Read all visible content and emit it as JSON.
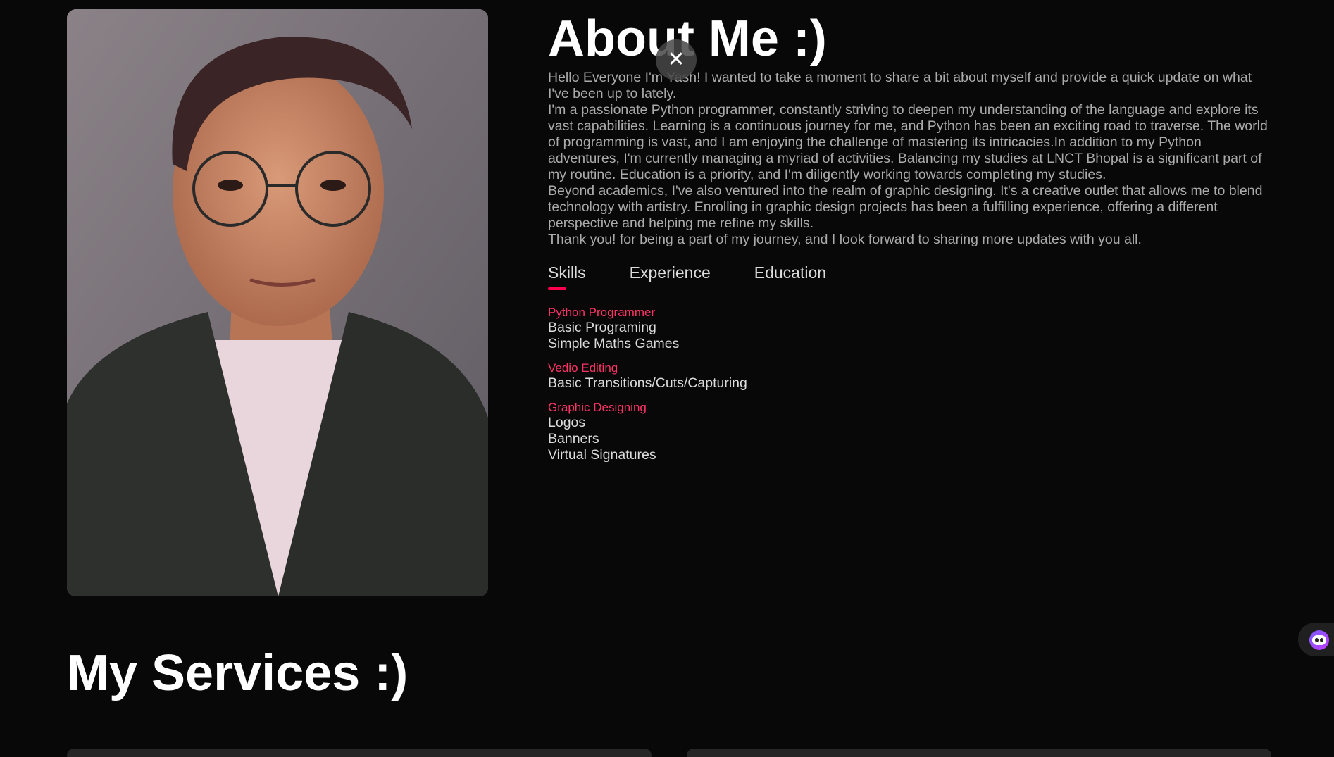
{
  "about": {
    "title": "About Me :)",
    "paragraphs": [
      "Hello Everyone I'm Yash! I wanted to take a moment to share a bit about myself and provide a quick update on what I've been up to lately.",
      "I'm a passionate Python programmer, constantly striving to deepen my understanding of the language and explore its vast capabilities. Learning is a continuous journey for me, and Python has been an exciting road to traverse. The world of programming is vast, and I am enjoying the challenge of mastering its intricacies.In addition to my Python adventures, I'm currently managing a myriad of activities. Balancing my studies at LNCT Bhopal is a significant part of my routine. Education is a priority, and I'm diligently working towards completing my studies.",
      "Beyond academics, I've also ventured into the realm of graphic designing. It's a creative outlet that allows me to blend technology with artistry. Enrolling in graphic design projects has been a fulfilling experience, offering a different perspective and helping me refine my skills.",
      "Thank you! for being a part of my journey, and I look forward to sharing more updates with you all."
    ],
    "tabs": [
      "Skills",
      "Experience",
      "Education"
    ],
    "active_tab": "Skills",
    "skills": [
      {
        "title": "Python Programmer",
        "lines": [
          "Basic Programing",
          "Simple Maths Games"
        ]
      },
      {
        "title": "Vedio Editing",
        "lines": [
          "Basic Transitions/Cuts/Capturing"
        ]
      },
      {
        "title": "Graphic Designing",
        "lines": [
          "Logos",
          "Banners",
          "Virtual Signatures"
        ]
      }
    ]
  },
  "services": {
    "title": "My Services :)"
  },
  "icons": {
    "close": "close-icon",
    "assistant": "assistant-widget-icon"
  },
  "colors": {
    "background": "#080808",
    "accent": "#ff004f",
    "heading": "#ffffff",
    "body_text": "#ababab"
  }
}
